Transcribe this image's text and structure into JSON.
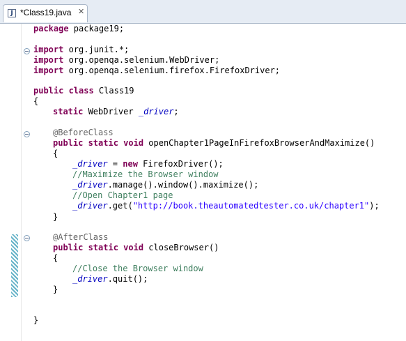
{
  "tab": {
    "title": "*Class19.java",
    "icon_text": "J",
    "close_symbol": "✕"
  },
  "code": {
    "package_kw": "package",
    "package_rest": " package19;",
    "import1_kw": "import",
    "import1_rest": " org.junit.*;",
    "import2_kw": "import",
    "import2_rest": " org.openqa.selenium.WebDriver;",
    "import3_kw": "import",
    "import3_rest": " org.openqa.selenium.firefox.FirefoxDriver;",
    "class_kw": "public class",
    "class_name": " Class19",
    "brace_open": "{",
    "field_kw": "static",
    "field_type": " WebDriver ",
    "field_name": "_driver",
    "field_end": ";",
    "before_annotation": "@BeforeClass",
    "method1_kw": "public static void",
    "method1_name": " openChapter1PageInFirefoxBrowserAndMaximize()",
    "m1_open": "{",
    "m1_l1_field": "_driver",
    "m1_l1_mid": " = ",
    "m1_l1_kw": "new",
    "m1_l1_rest": " FirefoxDriver();",
    "m1_comment1": "//Maximize the Browser window",
    "m1_l3_field": "_driver",
    "m1_l3_rest": ".manage().window().maximize();",
    "m1_comment2": "//Open Chapter1 page",
    "m1_l5_field": "_driver",
    "m1_l5_mid": ".get(",
    "m1_l5_str": "\"http://book.theautomatedtester.co.uk/chapter1\"",
    "m1_l5_end": ");",
    "m1_close": "}",
    "after_annotation": "@AfterClass",
    "method2_kw": "public static void",
    "method2_name": " closeBrowser()",
    "m2_open": "{",
    "m2_comment": "//Close the Browser window",
    "m2_l2_field": "_driver",
    "m2_l2_rest": ".quit();",
    "m2_close": "}",
    "class_close": "}"
  }
}
